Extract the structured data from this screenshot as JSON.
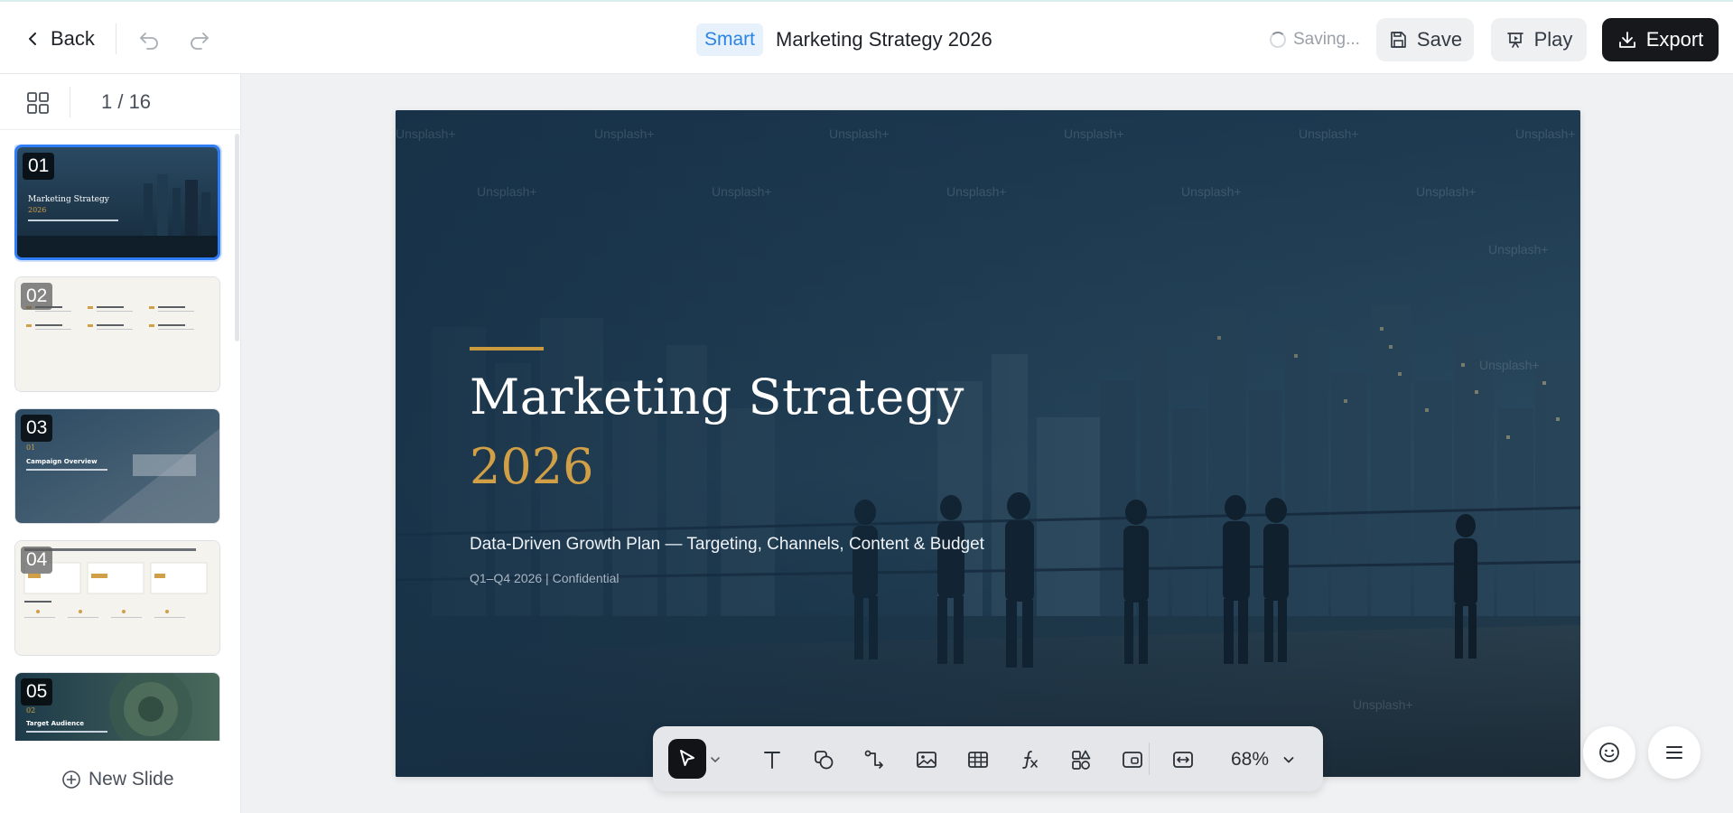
{
  "header": {
    "back_label": "Back",
    "smart_badge": "Smart",
    "title": "Marketing Strategy 2026",
    "saving_label": "Saving...",
    "save_label": "Save",
    "play_label": "Play",
    "export_label": "Export"
  },
  "sidebar": {
    "page_counter": "1 / 16",
    "new_slide_label": "New Slide",
    "thumbnails": [
      {
        "num": "01",
        "title": "Marketing Strategy",
        "sub": "2026",
        "active": true
      },
      {
        "num": "02"
      },
      {
        "num": "03",
        "sub": "01",
        "title": "Campaign Overview"
      },
      {
        "num": "04"
      },
      {
        "num": "05",
        "sub": "02",
        "title": "Target Audience"
      }
    ]
  },
  "slide": {
    "title": "Marketing Strategy",
    "year": "2026",
    "subtitle": "Data-Driven Growth Plan — Targeting, Channels, Content & Budget",
    "meta": "Q1–Q4 2026 | Confidential",
    "watermark": "Unsplash+"
  },
  "toolbar": {
    "zoom_label": "68%",
    "tools": [
      "select-icon",
      "text-icon",
      "shape-icon",
      "connector-icon",
      "image-icon",
      "table-icon",
      "formula-icon",
      "components-icon",
      "media-icon",
      "fit-icon"
    ]
  },
  "colors": {
    "accent_gold": "#d19f45",
    "selection_blue": "#2f7df6",
    "smart_blue": "#2b83e2",
    "slide_navy": "#1c3a52"
  }
}
